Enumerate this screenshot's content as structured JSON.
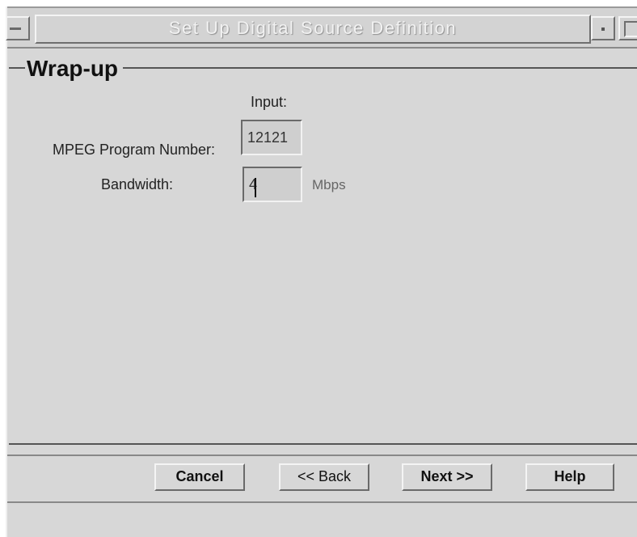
{
  "window": {
    "title": "Set Up Digital Source Definition"
  },
  "section": {
    "title": "Wrap-up"
  },
  "form": {
    "input_header": "Input:",
    "program_number_label": "MPEG Program Number:",
    "program_number_value": "12121",
    "bandwidth_label": "Bandwidth:",
    "bandwidth_value": "4",
    "bandwidth_unit": "Mbps"
  },
  "buttons": {
    "cancel": "Cancel",
    "back": "<< Back",
    "next": "Next >>",
    "help": "Help"
  },
  "icons": {
    "window_menu": "window-menu-icon",
    "minimize": "minimize-icon",
    "maximize": "maximize-icon"
  }
}
